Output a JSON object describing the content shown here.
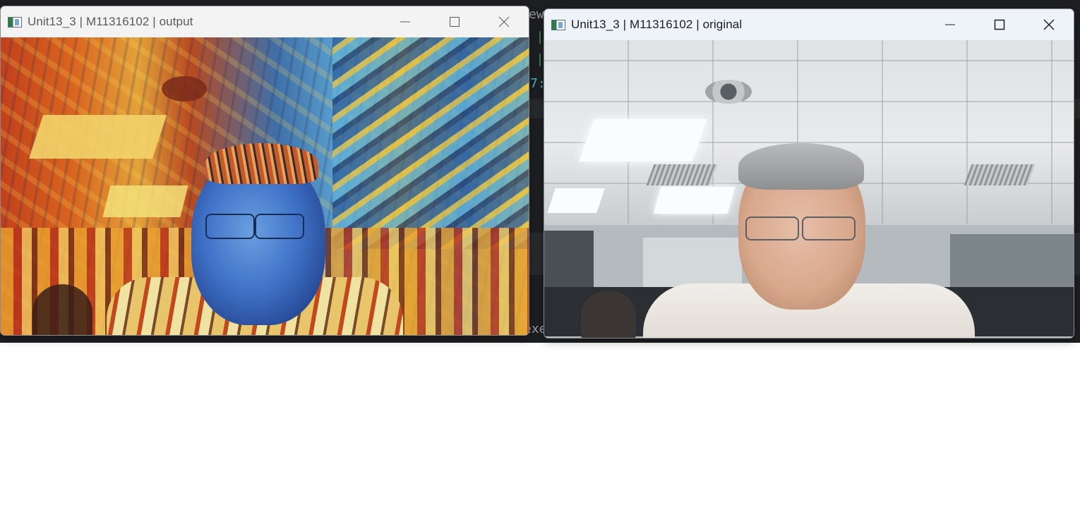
{
  "windows": {
    "output": {
      "title": "Unit13_3 | M11316102 | output",
      "controls": {
        "minimize": "minimize",
        "maximize": "maximize",
        "close": "close"
      }
    },
    "original": {
      "title": "Unit13_3 | M11316102 | original",
      "controls": {
        "minimize": "minimize",
        "maximize": "maximize",
        "close": "close"
      }
    }
  },
  "background_editor": {
    "fragments": [
      "ew",
      "7:",
      "exe"
    ]
  },
  "icons": {
    "app": "window-app-icon",
    "minimize": "minimize-icon",
    "maximize": "maximize-icon",
    "close": "close-icon"
  },
  "colors": {
    "editor_bg": "#1e1f22",
    "output_titlebar": "#f3f3f3",
    "original_titlebar": "#eef3f9"
  }
}
